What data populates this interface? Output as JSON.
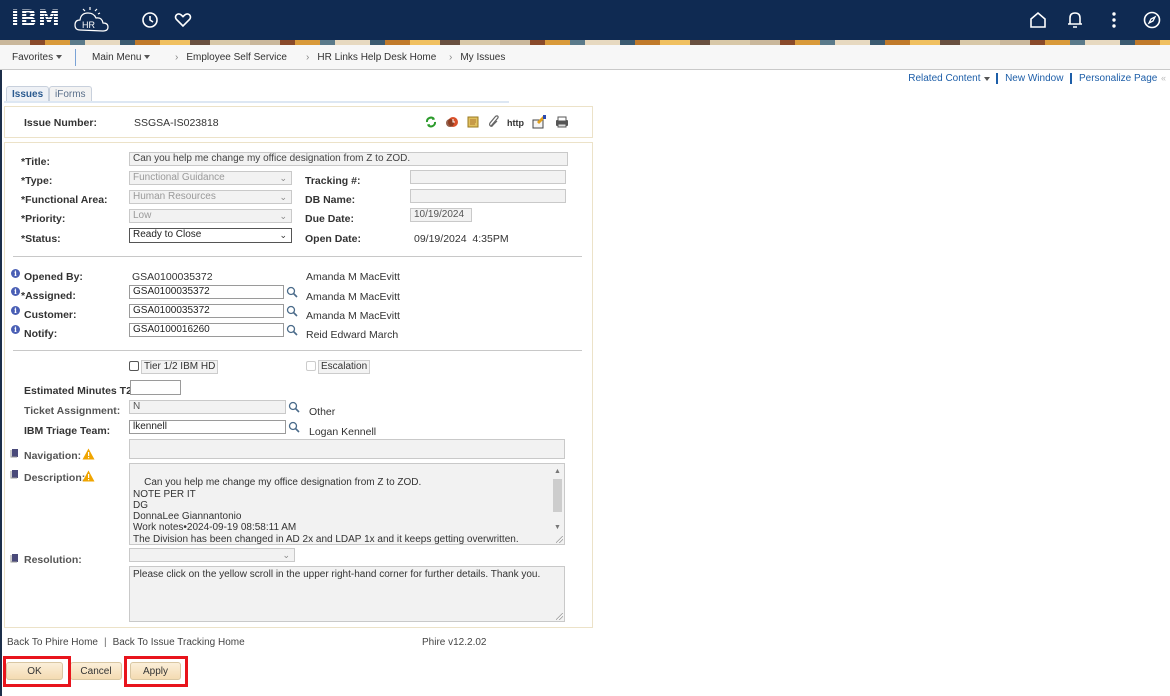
{
  "header": {
    "logo_text": "IBM",
    "hr_logo_text": "HR",
    "icons": [
      "history-icon",
      "favorites-heart-icon",
      "home-icon",
      "notifications-bell-icon",
      "actions-menu-icon",
      "navbar-compass-icon"
    ]
  },
  "nav": {
    "favorites": "Favorites",
    "main_menu": "Main Menu",
    "breadcrumbs": [
      "Employee Self Service",
      "HR Links Help Desk Home",
      "My Issues"
    ]
  },
  "related": {
    "related_content": "Related Content",
    "new_window": "New Window",
    "personalize_page": "Personalize Page"
  },
  "tabs": [
    {
      "label": "Issues",
      "active": true
    },
    {
      "label": "iForms",
      "active": false
    }
  ],
  "issue": {
    "number_label": "Issue Number:",
    "number": "SSGSA-IS023818",
    "toolbar_icons": [
      "refresh-icon",
      "time-clock-icon",
      "scroll-icon",
      "attachment-paperclip-icon",
      "http-link-icon",
      "edit-folder-icon",
      "print-icon"
    ]
  },
  "form": {
    "title_label": "*Title:",
    "title": "Can you help me change my office designation from Z to ZOD.",
    "type_label": "*Type:",
    "type": "Functional Guidance",
    "functional_area_label": "*Functional Area:",
    "functional_area": "Human Resources",
    "priority_label": "*Priority:",
    "priority": "Low",
    "status_label": "*Status:",
    "status": "Ready to Close",
    "tracking_label": "Tracking #:",
    "tracking": "",
    "db_name_label": "DB Name:",
    "db_name": "",
    "due_date_label": "Due Date:",
    "due_date": "10/19/2024",
    "open_date_label": "Open Date:",
    "open_date": "09/19/2024  4:35PM",
    "opened_by_label": "Opened By:",
    "opened_by_id": "GSA0100035372",
    "opened_by_name": "Amanda M MacEvitt",
    "assigned_label": "*Assigned:",
    "assigned_id": "GSA0100035372",
    "assigned_name": "Amanda M MacEvitt",
    "customer_label": "Customer:",
    "customer_id": "GSA0100035372",
    "customer_name": "Amanda M MacEvitt",
    "notify_label": "Notify:",
    "notify_id": "GSA0100016260",
    "notify_name": "Reid Edward March",
    "tier_label": "Tier 1/2 IBM HD",
    "tier_checked": false,
    "escalation_label": "Escalation",
    "escalation_checked": false,
    "est_minutes_label": "Estimated Minutes T2:",
    "est_minutes": "",
    "ticket_assignment_label": "Ticket Assignment:",
    "ticket_assignment": "N",
    "ticket_assignment_desc": "Other",
    "triage_label": "IBM Triage Team:",
    "triage": "lkennell",
    "triage_name": "Logan Kennell",
    "navigation_label": "Navigation:",
    "navigation": "",
    "description_label": "Description:",
    "description": "Can you help me change my office designation from Z to ZOD.\nNOTE PER IT\nDG\nDonnaLee Giannantonio\nWork notes•2024-09-19 08:58:11 AM\nThe Division has been changed in AD 2x and LDAP 1x and it keeps getting overwritten.\nPlease ensure that the Division in HRLinks for this user is ZOD before sending it back to Directory",
    "resolution_label": "Resolution:",
    "resolution_select": "",
    "resolution_text": "Please click on the yellow scroll in the upper right-hand corner for further details. Thank you."
  },
  "footer": {
    "back_phire": "Back To Phire Home",
    "back_issue": "Back To Issue Tracking Home",
    "version": "Phire v12.2.02",
    "ok": "OK",
    "cancel": "Cancel",
    "apply": "Apply"
  },
  "colors": {
    "header_bg": "#0f2a52",
    "link": "#1d5ea8",
    "highlight": "#e8141c",
    "button_bg": "#f4dbb2"
  }
}
